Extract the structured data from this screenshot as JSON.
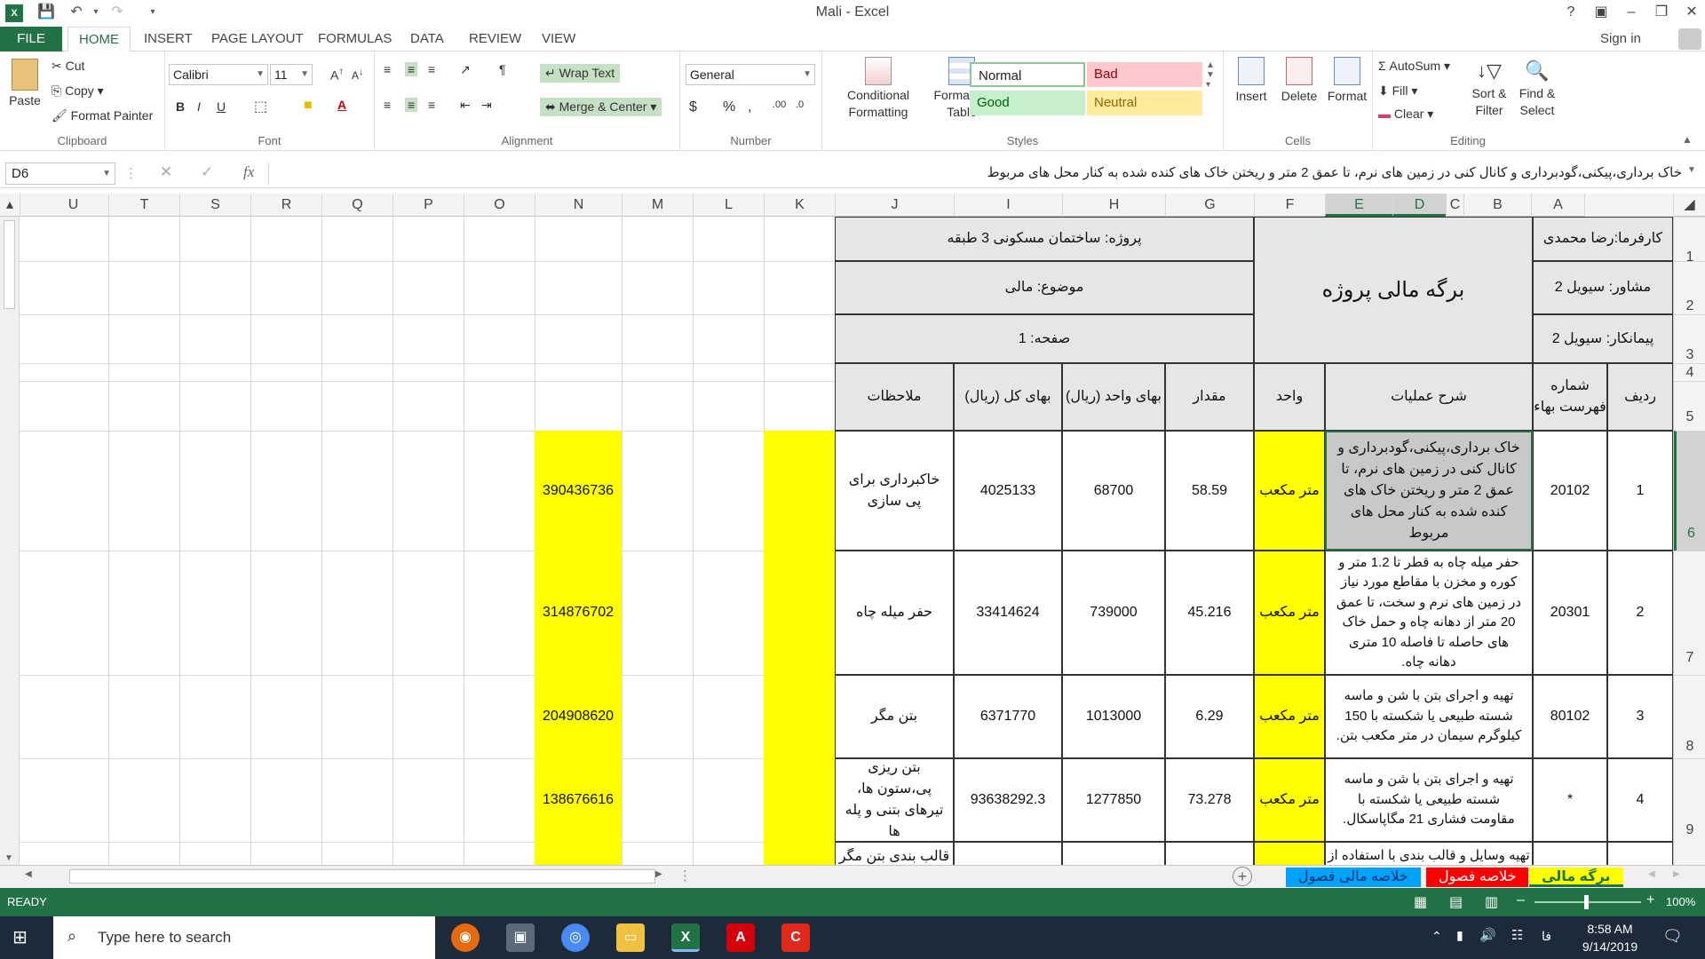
{
  "window": {
    "title": "Mali - Excel",
    "sign_in": "Sign in"
  },
  "tabs": [
    "FILE",
    "HOME",
    "INSERT",
    "PAGE LAYOUT",
    "FORMULAS",
    "DATA",
    "REVIEW",
    "VIEW"
  ],
  "ribbon": {
    "clipboard": {
      "paste": "Paste",
      "cut": "Cut",
      "copy": "Copy",
      "format_painter": "Format Painter",
      "label": "Clipboard"
    },
    "font": {
      "name": "Calibri",
      "size": "11",
      "label": "Font"
    },
    "alignment": {
      "wrap": "Wrap Text",
      "merge": "Merge & Center",
      "label": "Alignment"
    },
    "number": {
      "format": "General",
      "currency": "$",
      "percent": "%",
      "comma": ",",
      "label": "Number"
    },
    "styles": {
      "conditional": "Conditional Formatting",
      "format_table": "Format as Table",
      "normal": "Normal",
      "bad": "Bad",
      "good": "Good",
      "neutral": "Neutral",
      "label": "Styles"
    },
    "cells": {
      "insert": "Insert",
      "delete": "Delete",
      "format": "Format",
      "label": "Cells"
    },
    "editing": {
      "autosum": "AutoSum",
      "fill": "Fill",
      "clear": "Clear",
      "sort": "Sort & Filter",
      "find": "Find & Select",
      "label": "Editing"
    }
  },
  "formula_bar": {
    "name_box": "D6",
    "fx": "fx",
    "content": "خاک برداری،پیکنی،گودبرداری و کانال کنی در زمین های نرم، تا عمق 2 متر و ریختن خاک های کنده شده به کنار محل های مربوط"
  },
  "columns": [
    "U",
    "T",
    "S",
    "R",
    "Q",
    "P",
    "O",
    "N",
    "M",
    "L",
    "K",
    "J",
    "I",
    "H",
    "G",
    "F",
    "E",
    "D",
    "C",
    "B",
    "A"
  ],
  "rows": [
    "1",
    "2",
    "3",
    "4",
    "5",
    "6",
    "7",
    "8",
    "9"
  ],
  "sheet": {
    "header": {
      "employer": "کارفرما:رضا محمدی",
      "consultant": "مشاور: سیویل 2",
      "contractor": "پیمانکار: سیویل 2",
      "title": "برگه مالی پروژه",
      "project": "پروژه: ساختمان مسکونی 3 طبقه",
      "subject": "موضوع: مالی",
      "page": "صفحه: 1"
    },
    "col_headers": {
      "row": "ردیف",
      "price_list": "شماره فهرست بهاء",
      "description": "شرح عملیات",
      "unit": "واحد",
      "quantity": "مقدار",
      "unit_price": "بهای واحد (ریال)",
      "total": "بهای کل (ریال)",
      "notes": "ملاحظات"
    },
    "rows": [
      {
        "row": "1",
        "code": "20102",
        "desc": "خاک برداری،پیکنی،گودبرداری و کانال کنی در زمین های نرم، تا عمق 2 متر و ریختن خاک های کنده شده به کنار محل های مربوط",
        "unit": "متر مکعب",
        "qty": "58.59",
        "unit_price": "68700",
        "total": "4025133",
        "note": "خاکبرداری برای پی سازی",
        "n": "390436736"
      },
      {
        "row": "2",
        "code": "20301",
        "desc": "حفر میله چاه به قطر تا 1.2 متر و کوره و مخزن با مقاطع مورد نیاز در زمین های نرم و سخت، تا عمق 20 متر از دهانه چاه و حمل خاک های حاصله تا فاصله 10 متری دهانه چاه.",
        "unit": "متر مکعب",
        "qty": "45.216",
        "unit_price": "739000",
        "total": "33414624",
        "note": "حفر میله چاه",
        "n": "314876702"
      },
      {
        "row": "3",
        "code": "80102",
        "desc": "تهیه و اجرای بتن با شن و ماسه شسته طبیعی یا شکسته با 150 کیلوگرم سیمان در متر مکعب بتن.",
        "unit": "متر مکعب",
        "qty": "6.29",
        "unit_price": "1013000",
        "total": "6371770",
        "note": "بتن مگر",
        "n": "204908620"
      },
      {
        "row": "4",
        "code": "*",
        "desc": "تهیه و اجرای بتن با شن و ماسه شسته طبیعی یا شکسته با مقاومت فشاری 21 مگاپاسکال.",
        "unit": "متر مکعب",
        "qty": "73.278",
        "unit_price": "1277850",
        "total": "93638292.3",
        "note": "بتن ریزی پی،ستون ها، تیرهای بتنی و پله ها",
        "n": "138676616"
      },
      {
        "row": "",
        "code": "",
        "desc": "تهیه وسایل و قالب بندی با استفاده از",
        "unit": "",
        "qty": "",
        "unit_price": "",
        "total": "",
        "note": "قالب بندی بتن مگر و",
        "n": ""
      }
    ]
  },
  "sheet_tabs": [
    "برگه مالی",
    "خلاصه فصول",
    "خلاصه مالی فصول"
  ],
  "status": {
    "ready": "READY",
    "zoom": "100%"
  },
  "taskbar": {
    "search": "Type here to search",
    "time": "8:58 AM",
    "date": "9/14/2019",
    "lang": "فا"
  },
  "colors": {
    "excel_green": "#217346",
    "yellow": "#ffff00",
    "header_gray": "#e6e6e6",
    "selected_gray": "#c8c8c8"
  }
}
